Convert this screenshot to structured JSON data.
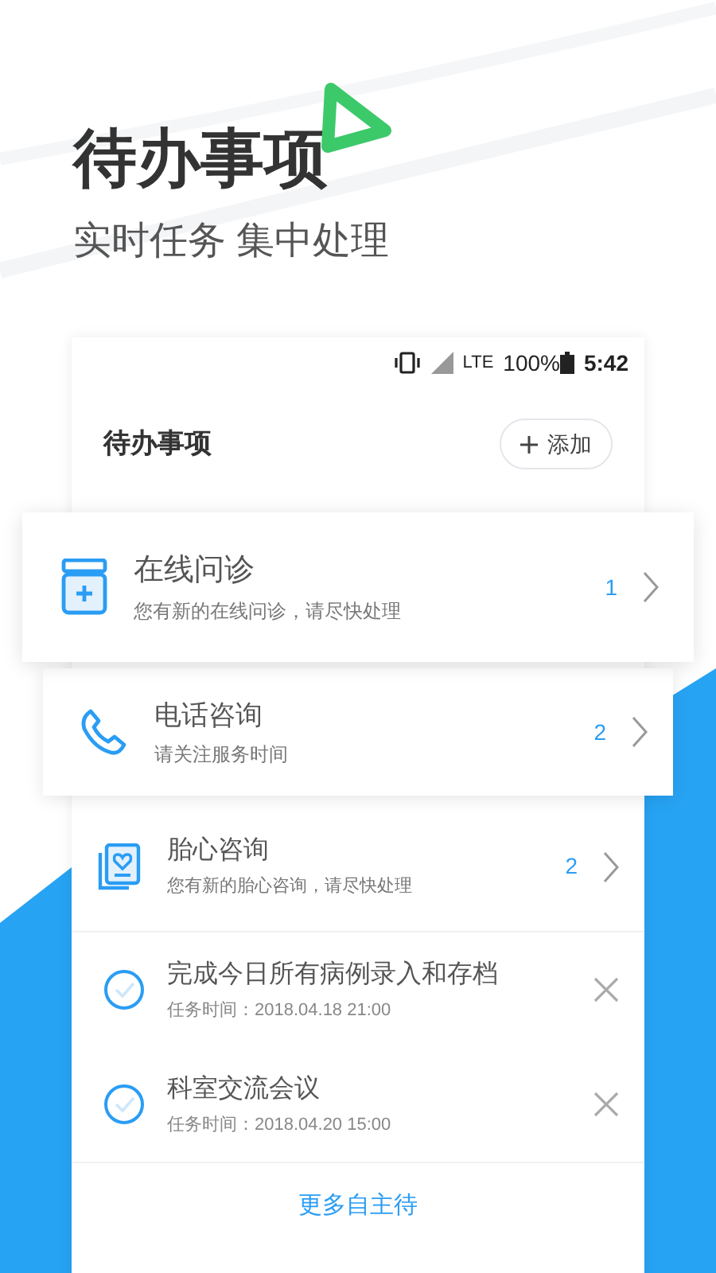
{
  "headline": {
    "title": "待办事项",
    "subtitle": "实时任务 集中处理"
  },
  "status_bar": {
    "network": "LTE",
    "battery": "100%",
    "time": "5:42"
  },
  "header": {
    "title": "待办事项",
    "add_button": "添加"
  },
  "categories": [
    {
      "kind": "clinic",
      "title": "在线问诊",
      "subtitle": "您有新的在线问诊，请尽快处理",
      "count": "1"
    },
    {
      "kind": "phone",
      "title": "电话咨询",
      "subtitle": "请关注服务时间",
      "count": "2"
    },
    {
      "kind": "heart",
      "title": "胎心咨询",
      "subtitle": "您有新的胎心咨询，请尽快处理",
      "count": "2"
    }
  ],
  "tasks": [
    {
      "title": "完成今日所有病例录入和存档",
      "time": "任务时间：2018.04.18 21:00",
      "done": false
    },
    {
      "title": "科室交流会议",
      "time": "任务时间：2018.04.20 15:00",
      "done": false
    }
  ],
  "footer_link": "更多自主待"
}
